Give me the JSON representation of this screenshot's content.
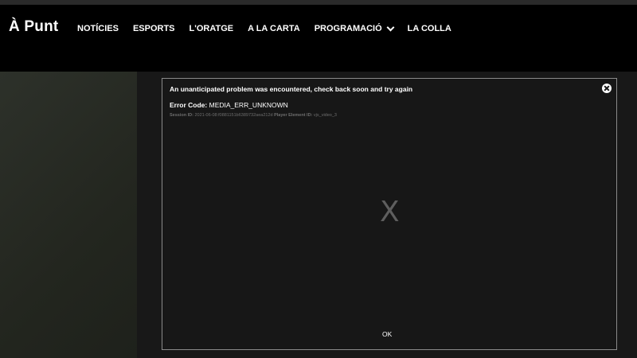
{
  "header": {
    "logo": "À Punt",
    "nav": [
      {
        "label": "NOTÍCIES"
      },
      {
        "label": "ESPORTS"
      },
      {
        "label": "L'ORATGE"
      },
      {
        "label": "A LA CARTA"
      },
      {
        "label": "PROGRAMACIÓ"
      },
      {
        "label": "LA COLLA"
      }
    ]
  },
  "error_dialog": {
    "title": "An unanticipated problem was encountered, check back soon and try again",
    "code_label": "Error Code:",
    "code_value": "MEDIA_ERR_UNKNOWN",
    "session_label": "Session ID:",
    "session_value": "2021-06-08:f0881151b6389732aea212d",
    "player_label": "Player Element ID:",
    "player_value": "vjs_video_3",
    "placeholder_glyph": "X",
    "ok_label": "OK"
  },
  "icons": {
    "close": "close-circle-icon",
    "dropdown": "chevron-down-icon"
  },
  "colors": {
    "header_bg": "#000000",
    "dialog_border": "#8a8a8a",
    "text": "#ffffff",
    "muted_text": "#6e6e6e"
  }
}
